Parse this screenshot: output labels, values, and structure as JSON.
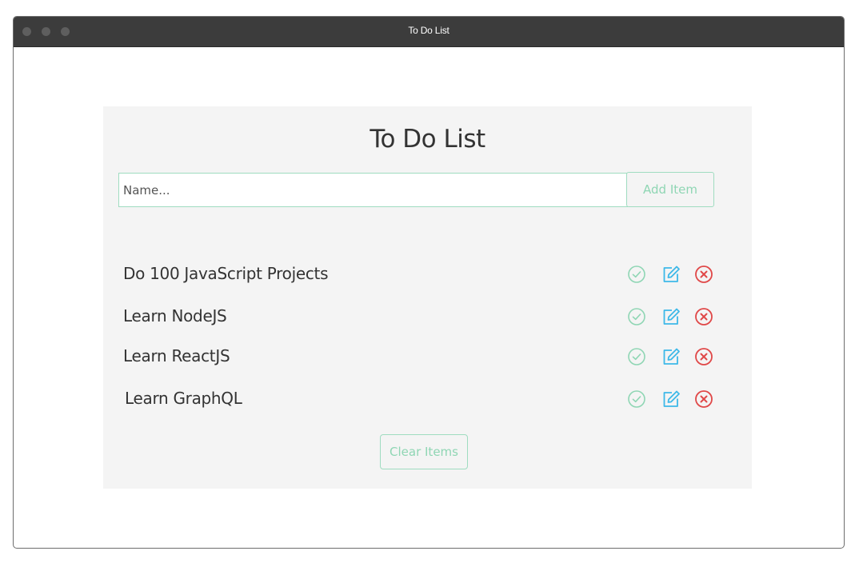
{
  "window": {
    "title": "To Do List"
  },
  "app": {
    "heading": "To Do List",
    "input": {
      "placeholder": "Name...",
      "value": ""
    },
    "add_button_label": "Add Item",
    "clear_button_label": "Clear Items",
    "items": [
      {
        "text": "Do 100 JavaScript Projects"
      },
      {
        "text": "Learn NodeJS"
      },
      {
        "text": "Learn ReactJS"
      },
      {
        "text": "Learn GraphQL"
      }
    ],
    "item_actions": {
      "complete_icon": "check-circle-icon",
      "edit_icon": "edit-icon",
      "delete_icon": "x-circle-icon"
    }
  },
  "colors": {
    "titlebar": "#3c3c3c",
    "panel": "#f4f4f4",
    "accent_green": "#8fd6b4",
    "edit_blue": "#3db8e8",
    "delete_red": "#e04848"
  }
}
